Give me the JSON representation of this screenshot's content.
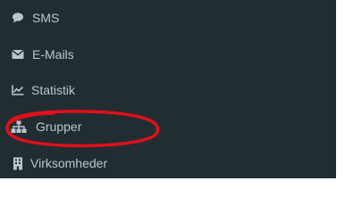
{
  "sidebar": {
    "items": [
      {
        "label": "SMS",
        "icon": "chat-bubble-icon"
      },
      {
        "label": "E-Mails",
        "icon": "envelope-icon"
      },
      {
        "label": "Statistik",
        "icon": "line-chart-icon"
      },
      {
        "label": "Grupper",
        "icon": "sitemap-icon"
      },
      {
        "label": "Virksomheder",
        "icon": "building-icon"
      }
    ]
  },
  "colors": {
    "sidebar_bg": "#222d32",
    "text": "#b8c7ce",
    "annotation": "#e0101a"
  }
}
